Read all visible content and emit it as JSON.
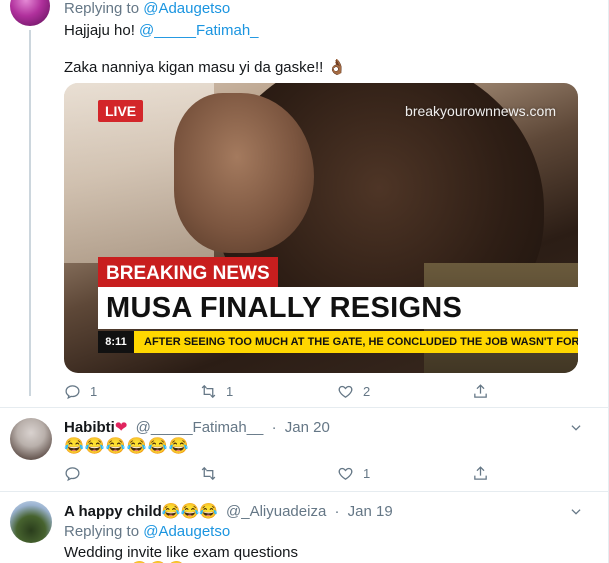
{
  "tweet1": {
    "replying_prefix": "Replying to",
    "replying_handle": "@Adaugetso",
    "line1_text": "Hajjaju ho! ",
    "line1_mention": "@_____Fatimah_",
    "line2": "Zaka nanniya kigan masu yi da gaske!! 👌🏾",
    "media": {
      "live": "LIVE",
      "watermark": "breakyourownnews.com",
      "breaking": "BREAKING NEWS",
      "headline": "MUSA FINALLY RESIGNS",
      "ticker_time": "8:11",
      "ticker_text": "AFTER SEEING TOO MUCH AT THE GATE, HE CONCLUDED THE JOB WASN'T FOR HIM"
    },
    "actions": {
      "replies": "1",
      "retweets": "1",
      "likes": "2"
    }
  },
  "tweet2": {
    "name": "Habibti",
    "heart": "❤",
    "handle": "@_____Fatimah__",
    "dot": "·",
    "date": "Jan 20",
    "text": "😂😂😂😂😂😂",
    "actions": {
      "replies": "",
      "retweets": "",
      "likes": "1"
    }
  },
  "tweet3": {
    "name": "A happy child😂😂😂",
    "handle": "@_Aliyuadeiza",
    "dot": "·",
    "date": "Jan 19",
    "replying_prefix": "Replying to",
    "replying_handle": "@Adaugetso",
    "text": "Wedding invite like exam questions",
    "cut_text": "😂😂😂"
  },
  "icons": [
    "reply-icon",
    "retweet-icon",
    "like-icon",
    "share-icon",
    "chevron-down-icon"
  ],
  "colors": {
    "link": "#1b95e0",
    "muted": "#657786",
    "like": "#e0245e",
    "live_red": "#d3262a",
    "ticker_yellow": "#ffd700"
  }
}
